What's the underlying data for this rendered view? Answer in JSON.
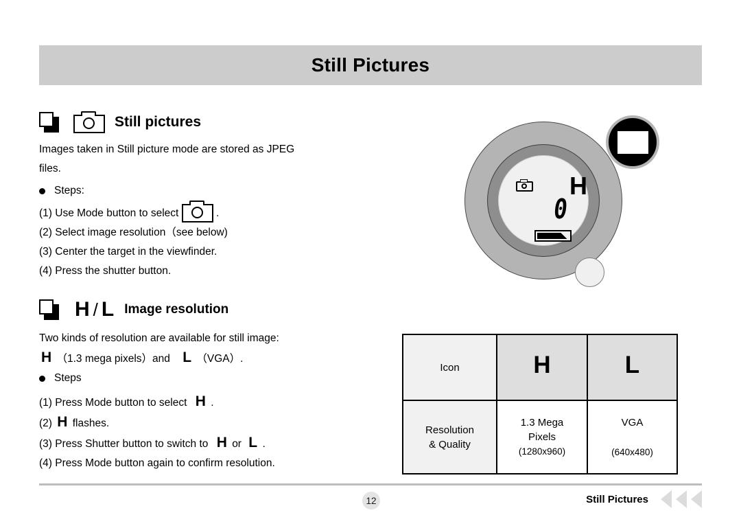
{
  "banner": {
    "title": "Still Pictures"
  },
  "still_pictures": {
    "heading": "Still pictures",
    "icon_stack": "stacked-square-icon",
    "icon_camera": "camera-icon",
    "intro_line1": "Images taken in Still picture mode are stored as JPEG",
    "intro_line2": "files.",
    "steps_label": "Steps:",
    "step1_pre": "(1) Use Mode button to select",
    "step1_post": ".",
    "step2": "(2) Select image resolution（see below)",
    "step3": "(3) Center the target in the viewfinder.",
    "step4": "(4) Press the shutter button."
  },
  "image_resolution": {
    "heading": "Image resolution",
    "glyph_h": "H",
    "glyph_slash": "/",
    "glyph_l": "L",
    "intro": "Two kinds of resolution are available for still image:",
    "desc_h": "H",
    "desc_h_text": "（1.3 mega pixels）and",
    "desc_l": "L",
    "desc_l_text": "（VGA）.",
    "steps_label": "Steps",
    "step1_pre": "(1) Press Mode button to select",
    "step1_glyph": "H",
    "step1_post": ".",
    "step2_pre": "(2)",
    "step2_glyph": "H",
    "step2_post": "flashes.",
    "step3_pre": "(3) Press Shutter button to switch to",
    "step3_glyph_h": "H",
    "step3_mid": "or",
    "step3_glyph_l": "L",
    "step3_post": ".",
    "step4": "(4) Press Mode button again to confirm resolution."
  },
  "dial": {
    "lcd_mode_icon": "camera-icon",
    "lcd_quality": "H",
    "lcd_counter": "0",
    "lcd_battery": "battery-icon",
    "shutter_button": "shutter-button",
    "mode_knob": "mode-knob"
  },
  "table": {
    "row1": {
      "label": "Icon",
      "h": "H",
      "l": "L"
    },
    "row2": {
      "label_line1": "Resolution",
      "label_line2": "& Quality",
      "h_main_line1": "1.3 Mega",
      "h_main_line2": "Pixels",
      "h_sub": "(1280x960)",
      "l_main": "VGA",
      "l_sub": "(640x480)"
    }
  },
  "footer": {
    "page_number": "12",
    "label": "Still Pictures",
    "arrow_icon": "triangle-left-icon"
  },
  "colors": {
    "banner_bg": "#cccccc",
    "table_head_bg": "#dedede",
    "table_label_bg": "#f1f1f1",
    "dial_outer": "#b4b4b4",
    "dial_mid": "#8e8e8e",
    "dial_face": "#f0f0f0",
    "arrow": "#dcdcdc"
  }
}
